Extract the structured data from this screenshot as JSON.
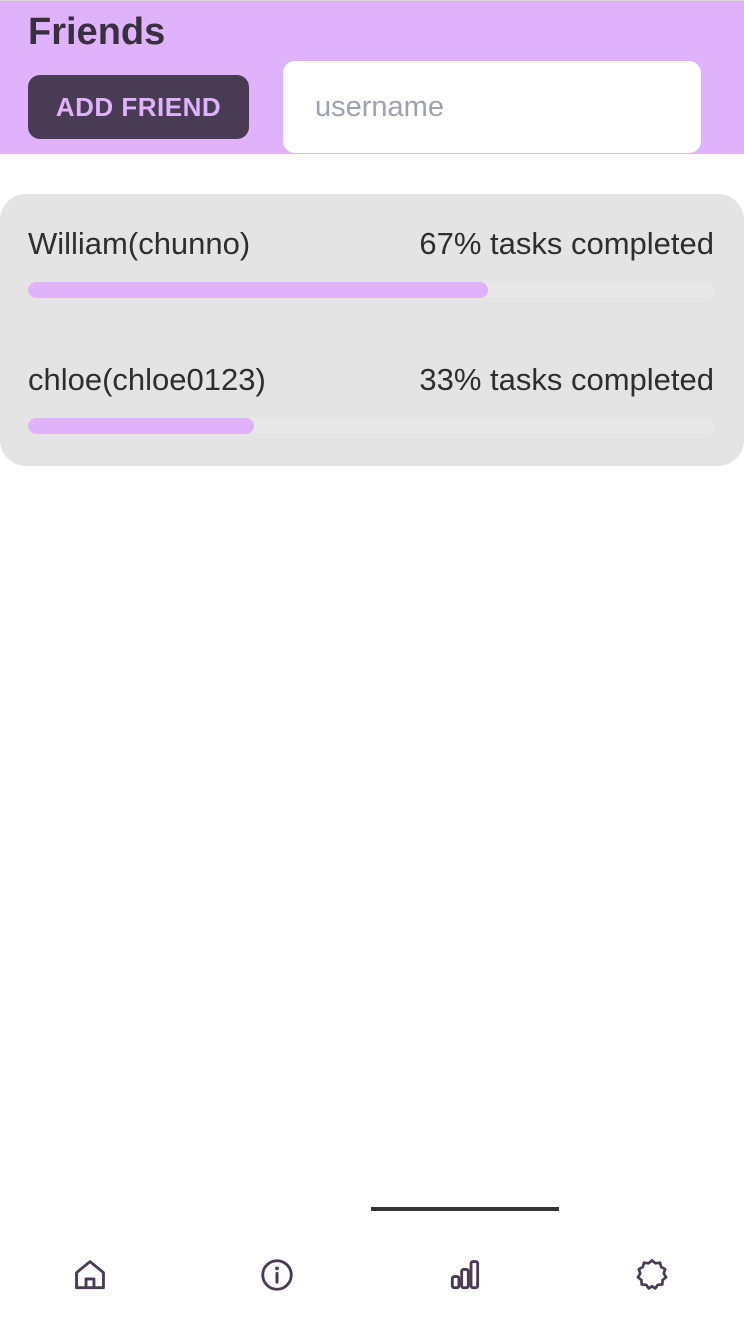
{
  "header": {
    "title": "Friends",
    "add_friend_label": "ADD FRIEND",
    "username_placeholder": "username",
    "username_value": ""
  },
  "friends": [
    {
      "name": "William(chunno)",
      "progress_text": "67% tasks completed",
      "progress_fraction": 0.67
    },
    {
      "name": "chloe(chloe0123)",
      "progress_text": "33% tasks completed",
      "progress_fraction": 0.33
    }
  ],
  "bottom_nav": {
    "items": [
      {
        "icon": "home-icon"
      },
      {
        "icon": "info-icon"
      },
      {
        "icon": "bar-chart-icon",
        "active": true
      },
      {
        "icon": "settings-gear-icon"
      }
    ]
  },
  "colors": {
    "accent": "#dfb2fb",
    "dark_accent": "#4a3b55",
    "card_background": "#e4e4e4",
    "text": "#2e2e2e"
  }
}
